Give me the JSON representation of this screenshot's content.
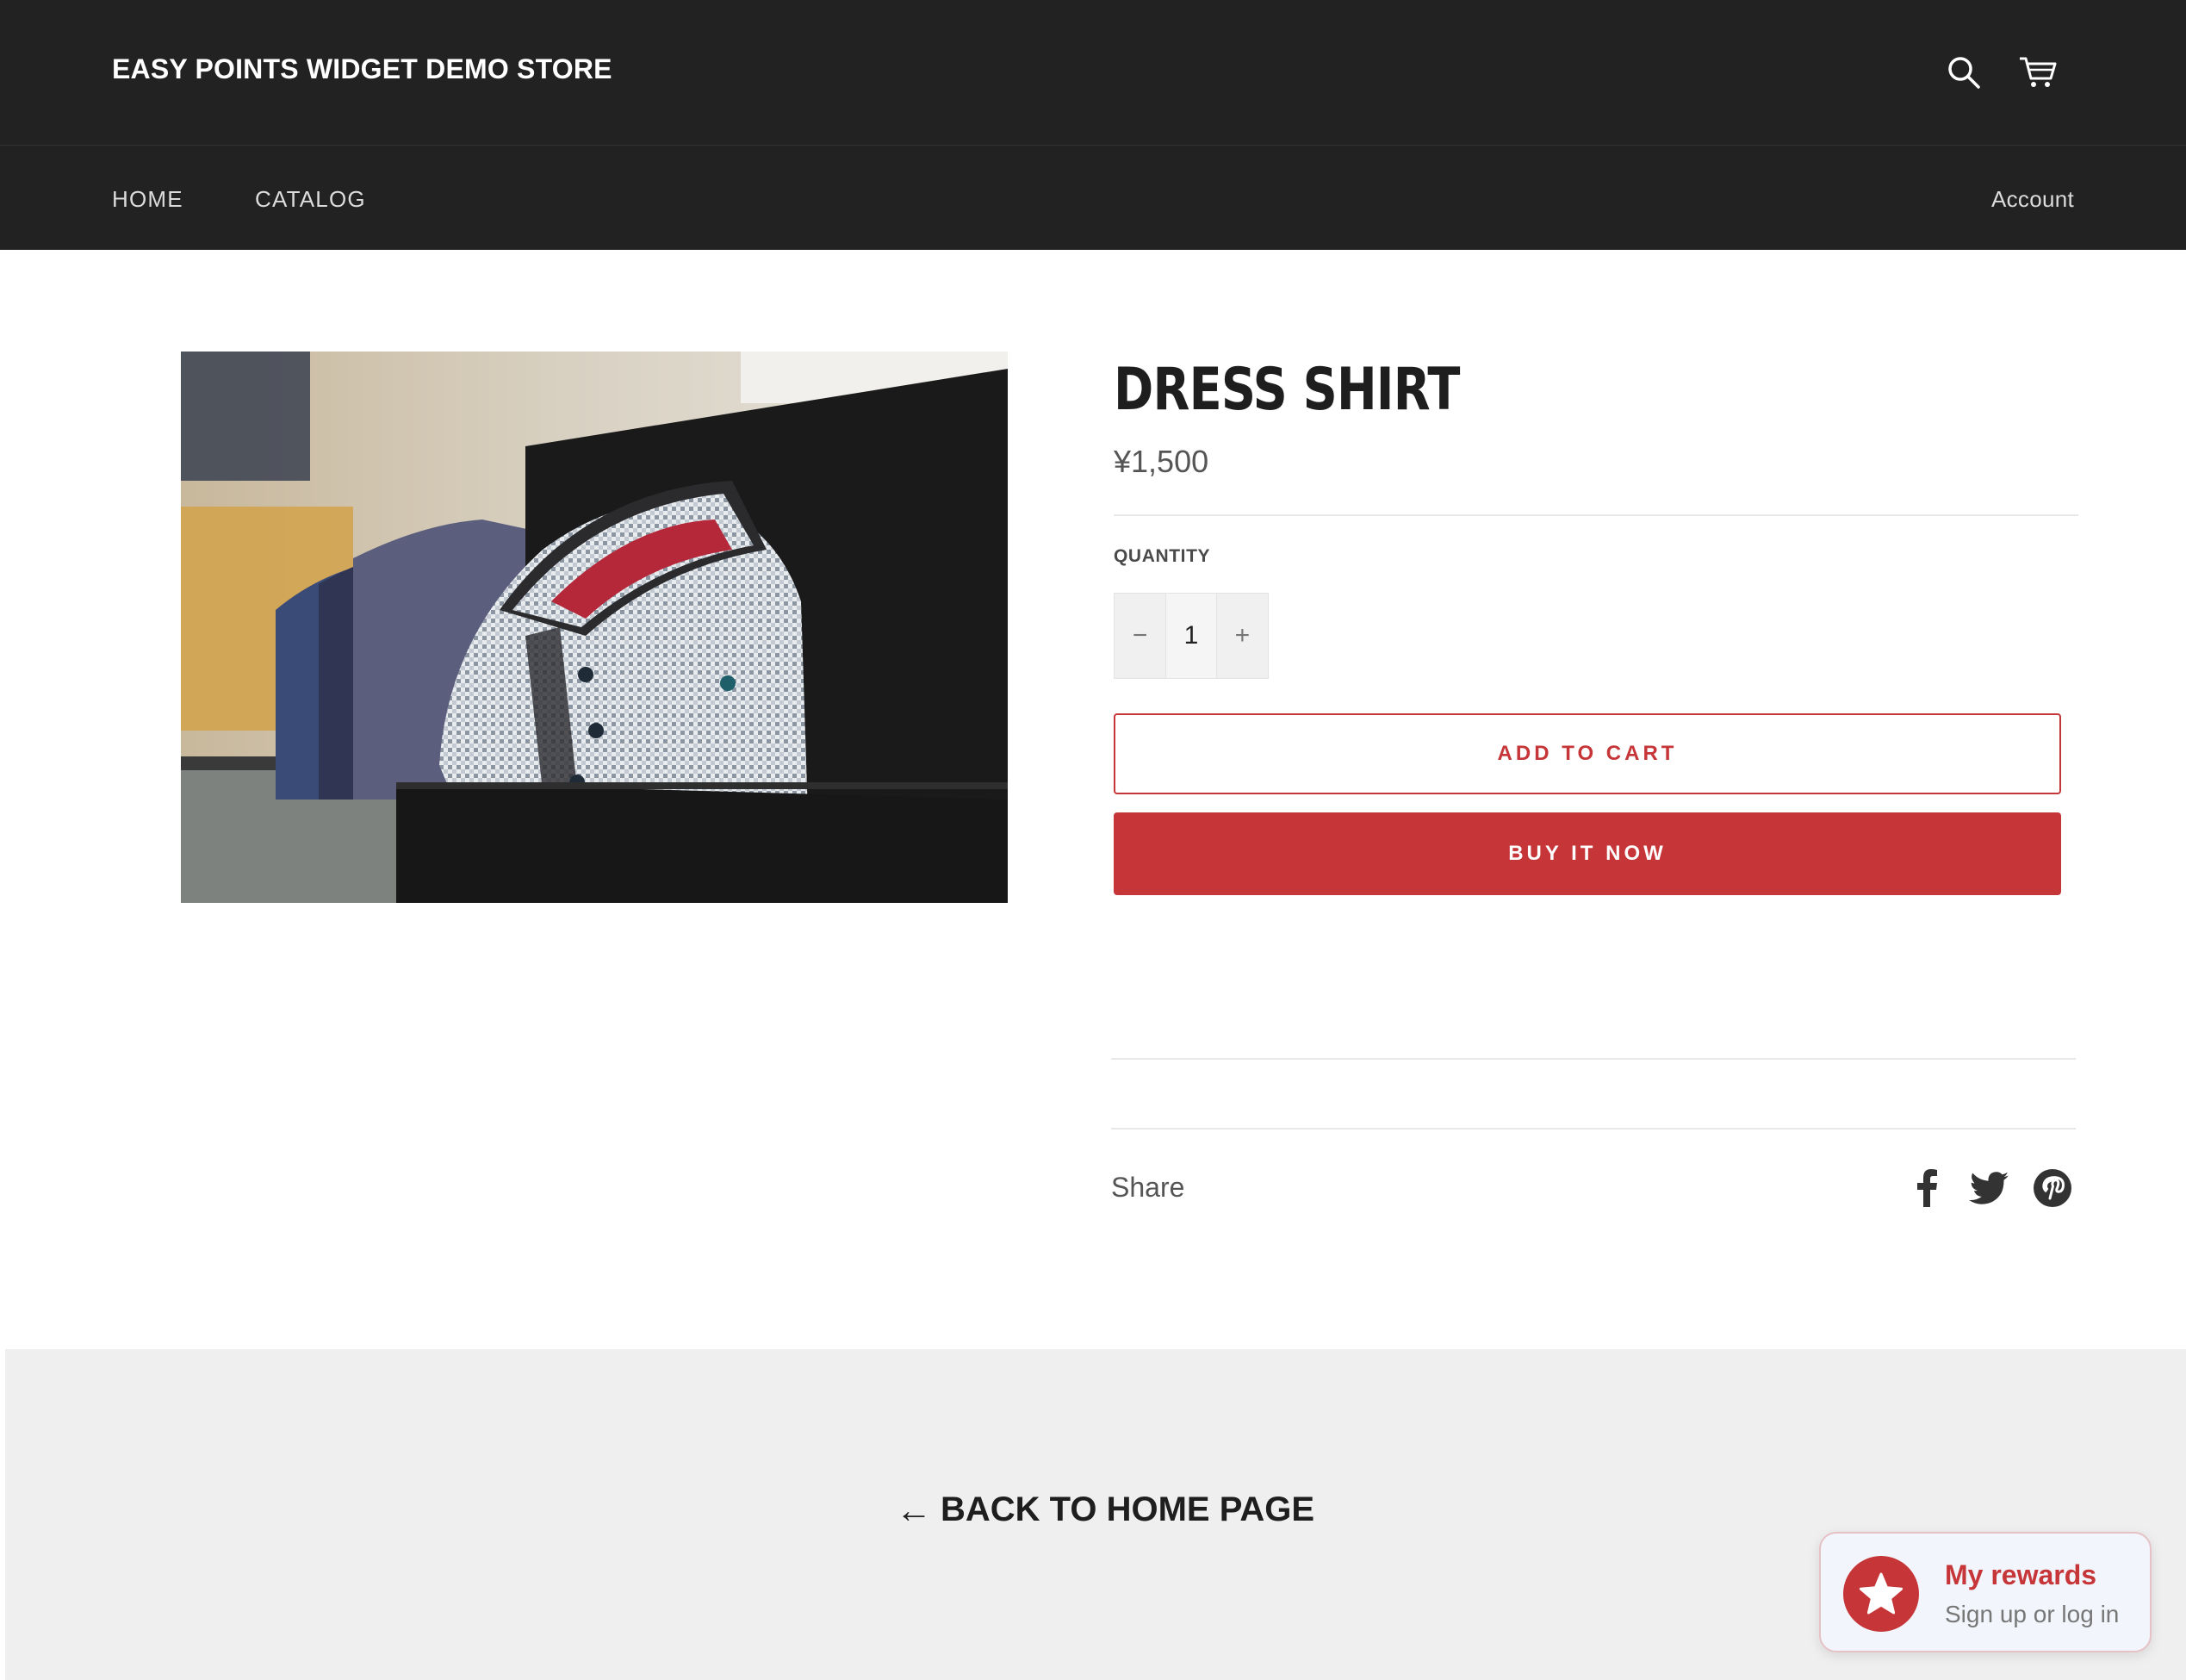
{
  "header": {
    "store_name": "EASY POINTS WIDGET DEMO STORE",
    "icons": [
      "search-icon",
      "cart-icon"
    ]
  },
  "nav": {
    "home": "HOME",
    "catalog": "CATALOG",
    "account": "Account"
  },
  "product": {
    "title": "DRESS SHIRT",
    "price": "¥1,500",
    "quantity_label": "QUANTITY",
    "quantity_value": "1",
    "decrement_symbol": "−",
    "increment_symbol": "+",
    "add_to_cart": "ADD TO CART",
    "buy_now": "BUY IT NOW",
    "image_icon": "folded-dress-shirt-photo"
  },
  "share": {
    "label": "Share",
    "icons": [
      "facebook-icon",
      "twitter-icon",
      "pinterest-icon"
    ]
  },
  "footer": {
    "back_arrow": "←",
    "back_label": "BACK TO HOME PAGE"
  },
  "rewards_widget": {
    "title": "My rewards",
    "subtitle": "Sign up or log in",
    "icon": "star-icon"
  },
  "colors": {
    "header_bg": "#222222",
    "accent": "#c63537",
    "footer_bg": "#efefef"
  }
}
